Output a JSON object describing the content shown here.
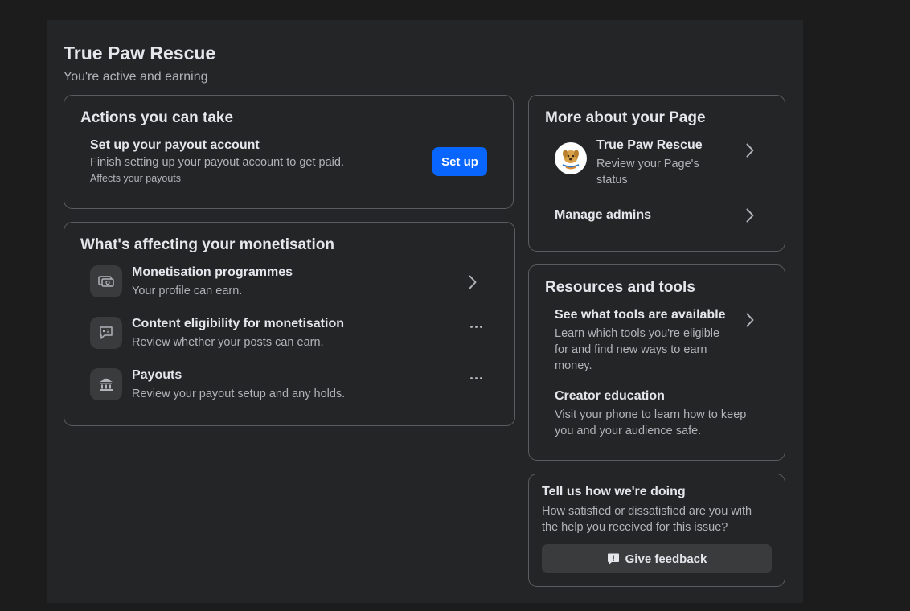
{
  "header": {
    "title": "True Paw Rescue",
    "subtitle": "You're active and earning"
  },
  "actions": {
    "title": "Actions you can take",
    "item": {
      "title": "Set up your payout account",
      "description": "Finish setting up your payout account to get paid.",
      "note": "Affects your payouts",
      "button_label": "Set up"
    }
  },
  "monetisation": {
    "title": "What's affecting your monetisation",
    "items": [
      {
        "title": "Monetisation programmes",
        "description": "Your profile can earn.",
        "icon": "money-icon",
        "action": "chevron-right-icon"
      },
      {
        "title": "Content eligibility for monetisation",
        "description": "Review whether your posts can earn.",
        "icon": "content-message-icon",
        "action": "more-icon"
      },
      {
        "title": "Payouts",
        "description": "Review your payout setup and any holds.",
        "icon": "bank-icon",
        "action": "more-icon"
      }
    ]
  },
  "more_about": {
    "title": "More about your Page",
    "page_item": {
      "name": "True Paw Rescue",
      "description_line1": "Review your Page's",
      "description_line2": "status"
    },
    "manage_admins": "Manage admins"
  },
  "resources": {
    "title": "Resources and tools",
    "items": [
      {
        "title": "See what tools are available",
        "lines": [
          "Learn which tools you're eligible",
          "for and find new ways to earn",
          "money."
        ]
      },
      {
        "title": "Creator education",
        "lines": [
          "Visit your phone to learn how to keep",
          "you and your audience safe."
        ]
      }
    ]
  },
  "feedback": {
    "title": "Tell us how we're doing",
    "lines": [
      "How satisfied or dissatisfied are you with",
      "the help you received for this issue?"
    ],
    "button_label": "Give feedback"
  },
  "colors": {
    "background": "#1c1c1d",
    "panel": "#242526",
    "primary_button": "#0866ff",
    "secondary_button": "#3a3b3c",
    "text_primary": "#e4e6eb",
    "text_secondary": "#b0b3b8"
  }
}
